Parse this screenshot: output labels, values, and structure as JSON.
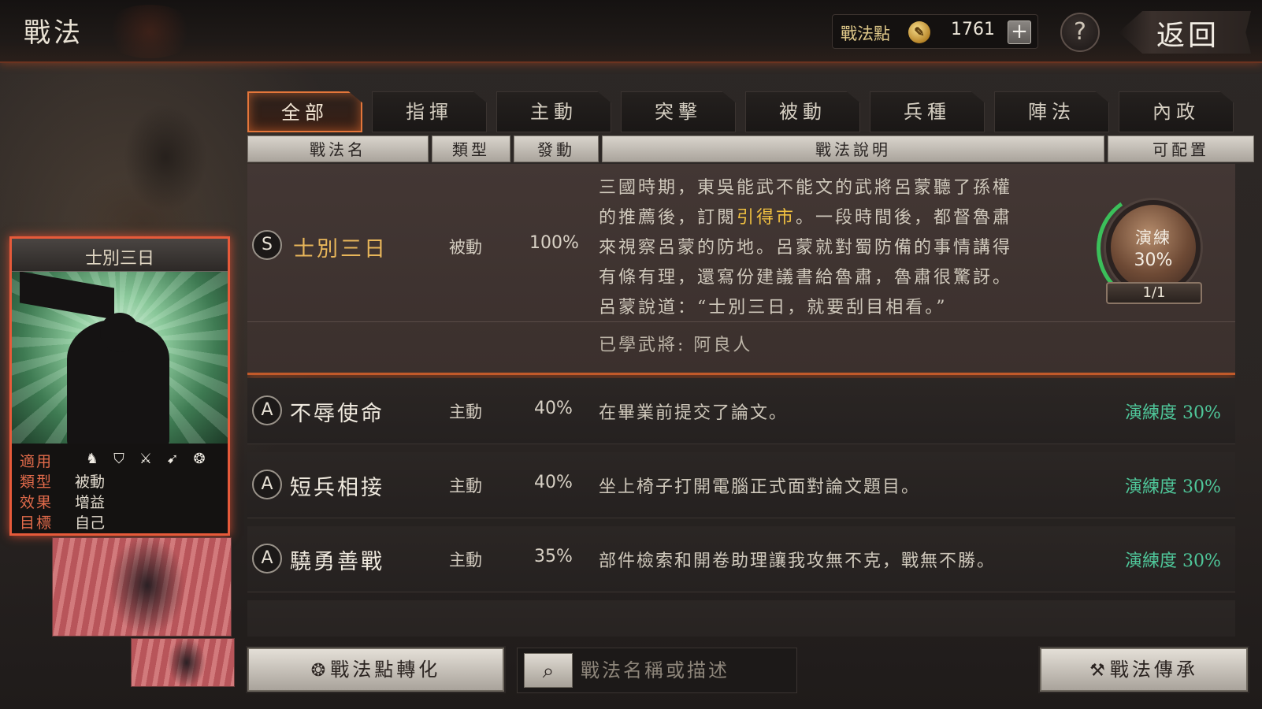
{
  "header": {
    "title": "戰法",
    "points_label": "戰法點",
    "points_value": "1761",
    "plus": "+",
    "help": "?",
    "back": "返回"
  },
  "card": {
    "title": "士別三日",
    "stats": [
      {
        "key": "適用",
        "value": ""
      },
      {
        "key": "類型",
        "value": "被動"
      },
      {
        "key": "效果",
        "value": "增益"
      },
      {
        "key": "目標",
        "value": "自己"
      }
    ],
    "unit_icons": [
      "cavalry-icon",
      "shield-icon",
      "crossed-swords-icon",
      "archer-icon",
      "wheel-icon"
    ]
  },
  "tabs": [
    "全部",
    "指揮",
    "主動",
    "突擊",
    "被動",
    "兵種",
    "陣法",
    "內政"
  ],
  "columns": [
    "戰法名",
    "類型",
    "發動",
    "戰法說明",
    "可配置"
  ],
  "selected_skill": {
    "rank": "S",
    "name": "士別三日",
    "type": "被動",
    "rate": "100%",
    "description_lines": [
      "三國時期，東吳能武不能文的武將呂蒙聽了孫權",
      "的推薦後，訂閱",
      "。一段時間後，都督魯肅",
      "來視察呂蒙的防地。呂蒙就對蜀防備的事情講得",
      "有條有理，還寫份建議書給魯肅，魯肅很驚訝。",
      "呂蒙說道：“士別三日，就要刮目相看。”"
    ],
    "highlight": "引得市",
    "learned": "已學武將: 阿良人",
    "practice_label": "演練",
    "practice_value": "30%",
    "practice_count": "1/1"
  },
  "skills": [
    {
      "rank": "A",
      "name": "不辱使命",
      "type": "主動",
      "rate": "40%",
      "description": "在畢業前提交了論文。",
      "practice": "演練度 30%"
    },
    {
      "rank": "A",
      "name": "短兵相接",
      "type": "主動",
      "rate": "40%",
      "description": "坐上椅子打開電腦正式面對論文題目。",
      "practice": "演練度 30%"
    },
    {
      "rank": "A",
      "name": "驍勇善戰",
      "type": "主動",
      "rate": "35%",
      "description": "部件檢索和開卷助理讓我攻無不克，戰無不勝。",
      "practice": "演練度 30%"
    }
  ],
  "bottom": {
    "convert_button": "戰法點轉化",
    "search_placeholder": "戰法名稱或描述",
    "inherit_button": "戰法傳承"
  },
  "colors": {
    "accent_orange": "#e4763a",
    "practice_green": "#4fc79a",
    "highlight_gold": "#f0c040"
  }
}
